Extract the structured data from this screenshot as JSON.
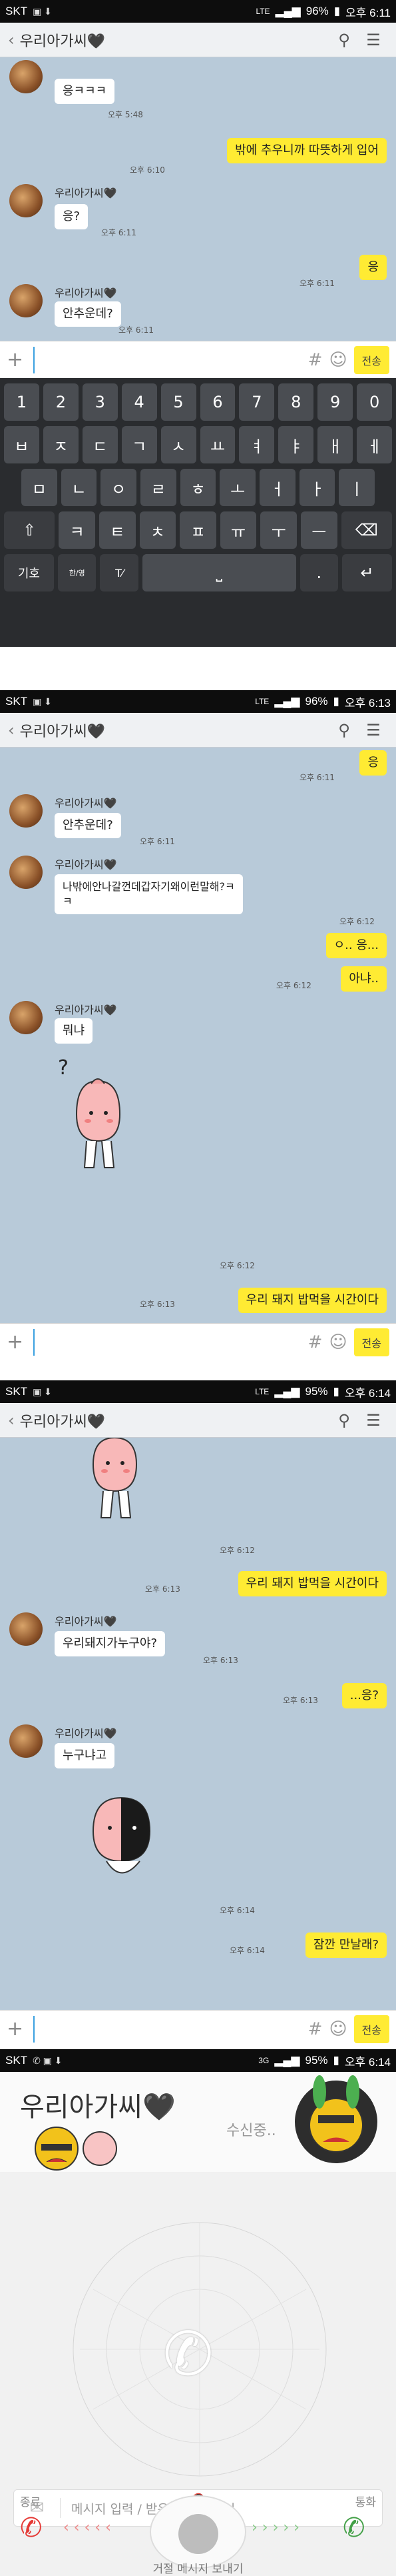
{
  "status_bars": [
    {
      "carrier": "SKT",
      "network": "LTE",
      "battery": "96%",
      "time": "오후 6:11"
    },
    {
      "carrier": "SKT",
      "network": "LTE",
      "battery": "96%",
      "time": "오후 6:13"
    },
    {
      "carrier": "SKT",
      "network": "LTE",
      "battery": "95%",
      "time": "오후 6:14"
    },
    {
      "carrier": "SKT",
      "network": "3G",
      "battery": "95%",
      "time": "오후 6:14"
    }
  ],
  "chat_title": "우리아가씨🖤",
  "sender_name": "우리아가씨🖤",
  "send_label": "전송",
  "panel1": {
    "m1": {
      "text": "응ㅋㅋㅋ",
      "time": "오후 5:48"
    },
    "m2": {
      "text": "밖에 추우니까 따뜻하게 입어",
      "time": "오후 6:10"
    },
    "m3": {
      "text": "응?",
      "time": "오후 6:11"
    },
    "m4": {
      "text": "응",
      "time": "오후 6:11"
    },
    "m5": {
      "text": "안추운데?",
      "time": "오후 6:11"
    }
  },
  "keyboard": {
    "row1": [
      "1",
      "2",
      "3",
      "4",
      "5",
      "6",
      "7",
      "8",
      "9",
      "0"
    ],
    "row2": [
      "ㅂ",
      "ㅈ",
      "ㄷ",
      "ㄱ",
      "ㅅ",
      "ㅛ",
      "ㅕ",
      "ㅑ",
      "ㅐ",
      "ㅔ"
    ],
    "row3": [
      "ㅁ",
      "ㄴ",
      "ㅇ",
      "ㄹ",
      "ㅎ",
      "ㅗ",
      "ㅓ",
      "ㅏ",
      "ㅣ"
    ],
    "row4": [
      "⇧",
      "ㅋ",
      "ㅌ",
      "ㅊ",
      "ㅍ",
      "ㅠ",
      "ㅜ",
      "ㅡ",
      "⌫"
    ],
    "row5_left": "기호",
    "row5_lang": "한/영",
    "row5_dot": ".",
    "row5_enter": "↵"
  },
  "panel2": {
    "m1": {
      "text": "응",
      "time": "오후 6:11"
    },
    "m2": {
      "text": "안추운데?",
      "time": "오후 6:11"
    },
    "m3": {
      "text": "나밖에안나갈껀데갑자기왜이런말해?ㅋ\nㅋ",
      "time": "오후 6:12"
    },
    "m4": {
      "text": "ㅇ.. 응...",
      "time": ""
    },
    "m5": {
      "text": "아냐..",
      "time": "오후 6:12"
    },
    "m6": {
      "text": "뭐냐",
      "time": ""
    },
    "sticker_time": "오후 6:12",
    "m7": {
      "text": "우리 돼지 밥먹을 시간이다",
      "time": "오후 6:13"
    }
  },
  "panel3": {
    "sticker_time": "오후 6:12",
    "m1": {
      "text": "우리 돼지 밥먹을 시간이다",
      "time": "오후 6:13"
    },
    "m2": {
      "text": "우리돼지가누구야?",
      "time": "오후 6:13"
    },
    "m3": {
      "text": "...응?",
      "time": "오후 6:13"
    },
    "m4": {
      "text": "누구냐고",
      "time": ""
    },
    "sticker_time2": "오후 6:14",
    "m5": {
      "text": "잠깐 만날래?",
      "time": "오후 6:14"
    }
  },
  "call": {
    "name": "우리아가씨🖤",
    "status": "수신중..",
    "message_placeholder": "메시지 입력 / 받은 메시지 확인",
    "decline": "종료",
    "accept": "통화",
    "reject_msg": "거절 메시지 보내기"
  },
  "colors": {
    "chat_bg": "#b8cad9",
    "my_bubble": "#ffeb33",
    "their_bubble": "#ffffff"
  }
}
